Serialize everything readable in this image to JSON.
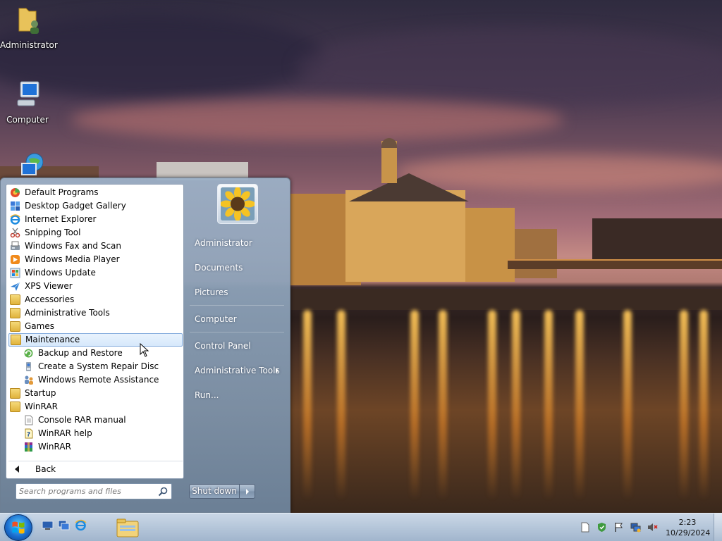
{
  "desktop": {
    "icons": [
      {
        "label": "Administrator",
        "icon": "user-folder-icon"
      },
      {
        "label": "Computer",
        "icon": "computer-icon"
      },
      {
        "label": "",
        "icon": "network-icon"
      }
    ]
  },
  "start_menu": {
    "programs": [
      {
        "label": "Default Programs",
        "icon": "default-programs-icon"
      },
      {
        "label": "Desktop Gadget Gallery",
        "icon": "gadget-icon"
      },
      {
        "label": "Internet Explorer",
        "icon": "ie-icon"
      },
      {
        "label": "Snipping Tool",
        "icon": "scissors-icon"
      },
      {
        "label": "Windows Fax and Scan",
        "icon": "fax-icon"
      },
      {
        "label": "Windows Media Player",
        "icon": "media-player-icon"
      },
      {
        "label": "Windows Update",
        "icon": "windows-update-icon"
      },
      {
        "label": "XPS Viewer",
        "icon": "xps-icon"
      },
      {
        "label": "Accessories",
        "icon": "folder-icon"
      },
      {
        "label": "Administrative Tools",
        "icon": "folder-icon"
      },
      {
        "label": "Games",
        "icon": "folder-icon"
      },
      {
        "label": "Maintenance",
        "icon": "folder-icon"
      },
      {
        "label": "Backup and Restore",
        "icon": "backup-icon"
      },
      {
        "label": "Create a System Repair Disc",
        "icon": "repair-disc-icon"
      },
      {
        "label": "Windows Remote Assistance",
        "icon": "remote-assistance-icon"
      },
      {
        "label": "Startup",
        "icon": "folder-icon"
      },
      {
        "label": "WinRAR",
        "icon": "folder-icon"
      },
      {
        "label": "Console RAR manual",
        "icon": "document-icon"
      },
      {
        "label": "WinRAR help",
        "icon": "help-icon"
      },
      {
        "label": "WinRAR",
        "icon": "winrar-icon"
      }
    ],
    "selected": "Maintenance",
    "back_label": "Back",
    "search_placeholder": "Search programs and files",
    "right_items": [
      {
        "label": "Administrator"
      },
      {
        "label": "Documents"
      },
      {
        "label": "Pictures"
      },
      {
        "label": "Computer"
      },
      {
        "label": "Control Panel"
      },
      {
        "label": "Administrative Tools",
        "has_submenu": true
      },
      {
        "label": "Run..."
      }
    ],
    "shutdown_label": "Shut down"
  },
  "taskbar": {
    "pinned": [
      "show-desktop-icon",
      "switch-windows-icon",
      "ie-icon",
      "explorer-folder-icon"
    ],
    "tray": [
      "document-icon",
      "security-icon",
      "action-center-flag-icon",
      "network-icon",
      "volume-muted-icon"
    ],
    "time": "2:23",
    "date": "10/29/2024"
  },
  "colors": {
    "selection_bg": "#d6e8fb",
    "selection_border": "#84acdd",
    "menu_right_pane": "#8ea3ba"
  }
}
